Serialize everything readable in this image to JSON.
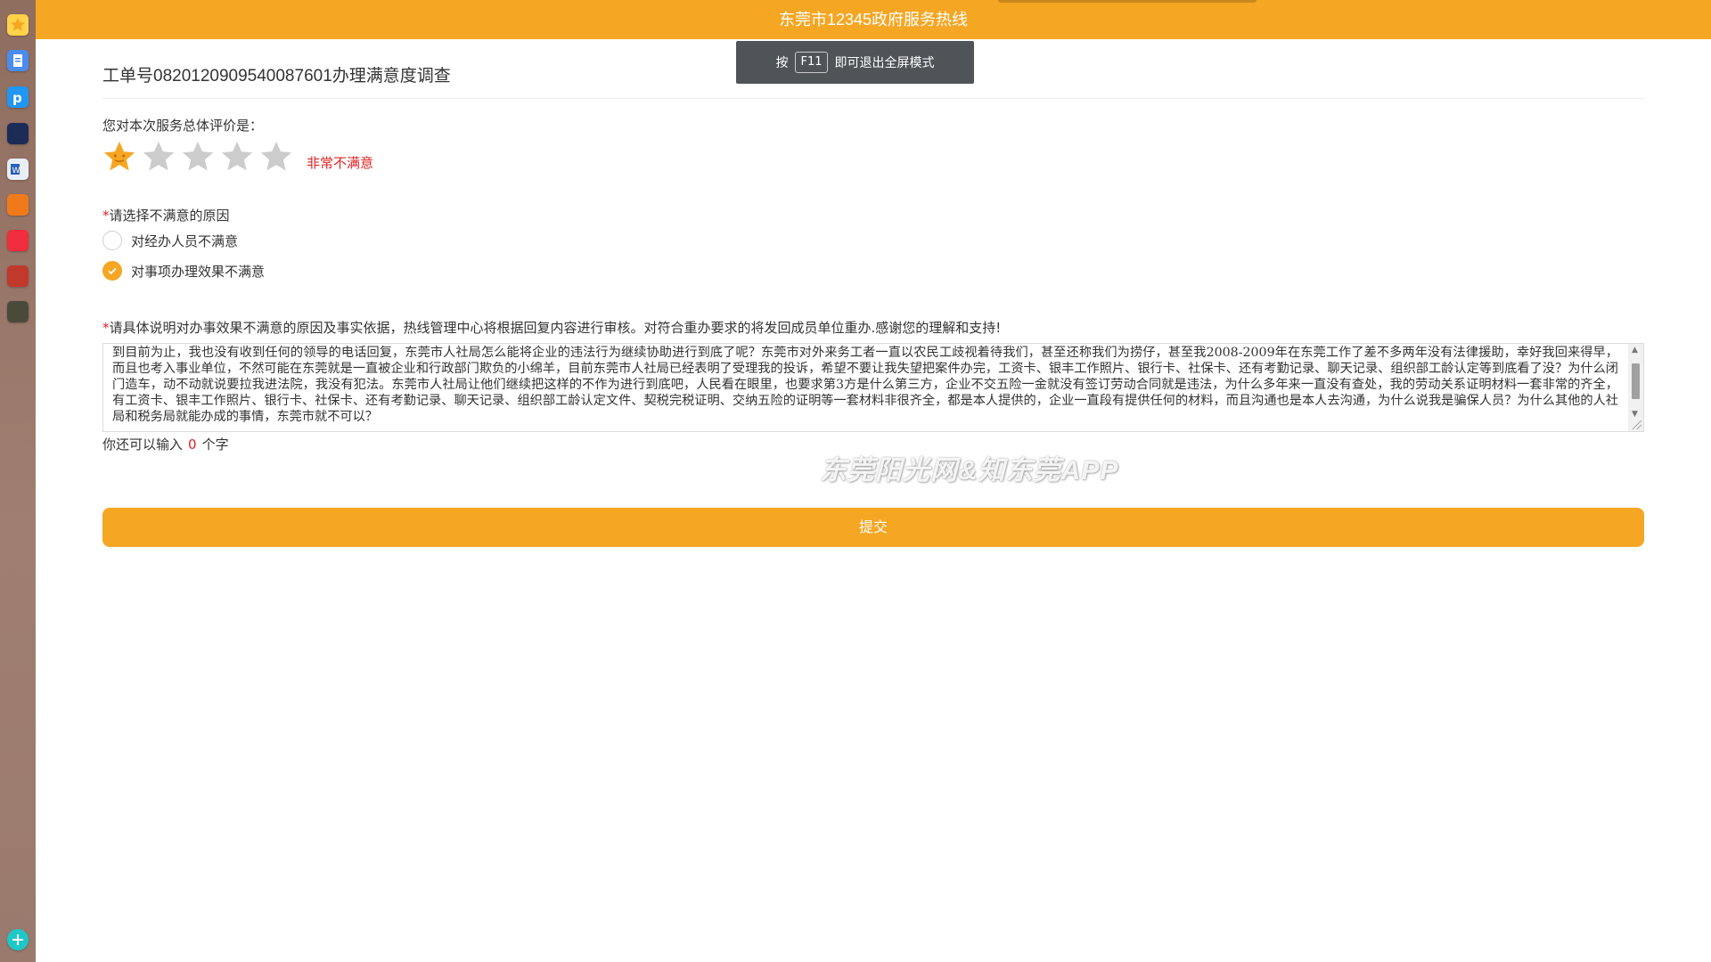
{
  "header": {
    "title": "东莞市12345政府服务热线"
  },
  "fullscreen_toast": {
    "before": "按",
    "key": "F11",
    "after": "即可退出全屏模式"
  },
  "survey": {
    "ticket_title": "工单号082012090954008760​1办理满意度调查",
    "rating_label": "您对本次服务总体评价是：",
    "rating": {
      "value": 1,
      "max": 5
    },
    "rating_text": "非常不满意",
    "reason_label": "请选择不满意的原因",
    "reason_options": [
      {
        "label": "对经办人员不满意",
        "checked": false
      },
      {
        "label": "对事项办理效果不满意",
        "checked": true
      }
    ],
    "detail_label": "请具体说明对办事效果不满意的原因及事实依据，热线管理中心将根据回复内容进行审核。对符合重办要求的将发回成员单位重办.感谢您的理解和支持!",
    "detail_text": "到目前为止，我也没有收到任何的领导的电话回复，东莞市人社局怎么能将企业的违法行为继续协助进行到底了呢？东莞市对外来务工者一直以农民工歧视着待我们，甚至还称我们为捞仔，甚至我2008-2009年在东莞工作了差不多两年没有法律援助，幸好我回来得早，而且也考入事业单位，不然可能在东莞就是一直被企业和行政部门欺负的小绵羊，目前东莞市人社局已经表明了受理我的投诉，希望不要让我失望把案件办完，工资卡、银丰工作照片、银行卡、社保卡、还有考勤记录、聊天记录、组织部工龄认定等到底看了没？为什么闭门造车，动不动就说要拉我进法院，我没有犯法。东莞市人社局让他们继续把这样的不作为进行到底吧，人民看在眼里，也要求第3方是什么第三方，企业不交五险一金就没有签订劳动合同就是违法，为什么多年来一直没有查处，我的劳动关系证明材料一套非常的齐全，有工资卡、银丰工作照片、银行卡、社保卡、还有考勤记录、聊天记录、组织部工龄认定文件、契税完税证明、交纳五险的证明等一套材料非很齐全，都是本人提供的，企业一直段有提供任何的材料，而且沟通也是本人去沟通，为什么说我是骗保人员？为什么其他的人社局和税务局就能办成的事情，东莞市就不可以？",
    "counter_before": "你还可以输入",
    "counter_value": "0",
    "counter_after": "个字",
    "submit_label": "提交"
  },
  "watermark": "东莞阳光网&知东莞APP",
  "sidebar_icons": [
    "favorites-icon",
    "docs-icon",
    "p-app-icon",
    "news-app-icon",
    "word-icon",
    "game-app-icon",
    "red-app-icon",
    "game2-app-icon",
    "game3-app-icon",
    "add-icon"
  ],
  "colors": {
    "accent": "#f5a623",
    "warning_text": "#e02020"
  }
}
